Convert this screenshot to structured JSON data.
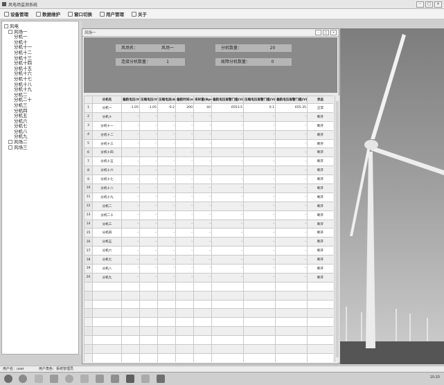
{
  "window": {
    "title": "风电场监测系统"
  },
  "menu": [
    {
      "label": "设备管理",
      "icon": "device-icon"
    },
    {
      "label": "数据维护",
      "icon": "data-icon"
    },
    {
      "label": "窗口切换",
      "icon": "window-icon"
    },
    {
      "label": "用户管理",
      "icon": "user-icon"
    },
    {
      "label": "关于",
      "icon": "info-icon"
    }
  ],
  "tree": {
    "root": "风电",
    "farm1": "风场一",
    "turbines": [
      "分机一",
      "分机十",
      "分机十一",
      "分机十二",
      "分机十三",
      "分机十四",
      "分机十五",
      "分机十六",
      "分机十七",
      "分机十八",
      "分机十九",
      "分机二",
      "分机二十",
      "分机三",
      "分机四",
      "分机五",
      "分机六",
      "分机七",
      "分机八",
      "分机九"
    ],
    "farm2": "风场二",
    "farm3": "风场三"
  },
  "inner": {
    "title": "风场一"
  },
  "info": {
    "farm_name_label": "风场名：",
    "farm_name_value": "风场一",
    "count_label": "分机数量：",
    "count_value": "20",
    "connected_label": "连接分机数量：",
    "connected_value": "1",
    "fault_label": "故障分机数量：",
    "fault_value": "0"
  },
  "table": {
    "columns": [
      "",
      "分机名",
      "偏航电压(V)",
      "压缩电压(V)",
      "压缩电流(A)",
      "偏航时间(ms)",
      "采样量(Bps)",
      "偏航电压报警门槛(V)",
      "压缩电压报警门槛(V)",
      "偏航电压报警门槛(V)",
      "状态"
    ],
    "rows": [
      [
        "1",
        "分机一",
        "-1.05",
        "-1.05",
        "-0.2",
        "200",
        "40",
        "6553.5",
        "0.1",
        "655.35",
        "正常"
      ],
      [
        "2",
        "分机十",
        "-",
        "-",
        "-",
        "-",
        "-",
        "-",
        "-",
        "-",
        "断开"
      ],
      [
        "3",
        "分机十一",
        "-",
        "-",
        "-",
        "-",
        "-",
        "-",
        "-",
        "-",
        "断开"
      ],
      [
        "4",
        "分机十二",
        "-",
        "-",
        "-",
        "-",
        "-",
        "-",
        "-",
        "-",
        "断开"
      ],
      [
        "5",
        "分机十三",
        "-",
        "-",
        "-",
        "-",
        "-",
        "-",
        "-",
        "-",
        "断开"
      ],
      [
        "6",
        "分机十四",
        "-",
        "-",
        "-",
        "-",
        "-",
        "-",
        "-",
        "-",
        "断开"
      ],
      [
        "7",
        "分机十五",
        "-",
        "-",
        "-",
        "-",
        "-",
        "-",
        "-",
        "-",
        "断开"
      ],
      [
        "8",
        "分机十六",
        "-",
        "-",
        "-",
        "-",
        "-",
        "-",
        "-",
        "-",
        "断开"
      ],
      [
        "9",
        "分机十七",
        "-",
        "-",
        "-",
        "-",
        "-",
        "-",
        "-",
        "-",
        "断开"
      ],
      [
        "10",
        "分机十八",
        "-",
        "-",
        "-",
        "-",
        "-",
        "-",
        "-",
        "-",
        "断开"
      ],
      [
        "11",
        "分机十九",
        "-",
        "-",
        "-",
        "-",
        "-",
        "-",
        "-",
        "-",
        "断开"
      ],
      [
        "12",
        "分机二",
        "-",
        "-",
        "-",
        "-",
        "-",
        "-",
        "-",
        "-",
        "断开"
      ],
      [
        "13",
        "分机二十",
        "-",
        "-",
        "-",
        "-",
        "-",
        "-",
        "-",
        "-",
        "断开"
      ],
      [
        "14",
        "分机三",
        "-",
        "-",
        "-",
        "-",
        "-",
        "-",
        "-",
        "-",
        "断开"
      ],
      [
        "15",
        "分机四",
        "-",
        "-",
        "-",
        "-",
        "-",
        "-",
        "-",
        "-",
        "断开"
      ],
      [
        "16",
        "分机五",
        "-",
        "-",
        "-",
        "-",
        "-",
        "-",
        "-",
        "-",
        "断开"
      ],
      [
        "17",
        "分机六",
        "-",
        "-",
        "-",
        "-",
        "-",
        "-",
        "-",
        "-",
        "断开"
      ],
      [
        "18",
        "分机七",
        "-",
        "-",
        "-",
        "-",
        "-",
        "-",
        "-",
        "-",
        "断开"
      ],
      [
        "19",
        "分机八",
        "-",
        "-",
        "-",
        "-",
        "-",
        "-",
        "-",
        "-",
        "断开"
      ],
      [
        "20",
        "分机九",
        "-",
        "-",
        "-",
        "-",
        "-",
        "-",
        "-",
        "-",
        "断开"
      ]
    ]
  },
  "status": {
    "user": "用户名：user",
    "role": "用户角色：系统管理员"
  },
  "taskbar": {
    "icons": [
      "start-icon",
      "browser-icon",
      "explorer-icon",
      "media-icon",
      "ie-icon",
      "folder-icon",
      "app-icon",
      "monitor-icon",
      "terminal-icon",
      "doc-icon",
      "window-icon"
    ],
    "clock": "10:20"
  }
}
